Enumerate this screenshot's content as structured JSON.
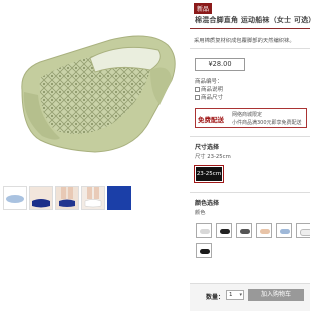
{
  "product": {
    "badge": "新品",
    "title": "棉混合脚直角 运动船袜（女士 可选）",
    "note": "采用棉质复材织成包覆脚部的天然编织袜。",
    "price": "¥28.00",
    "info": [
      "商品编号：",
      "商品说明",
      "商品尺寸"
    ],
    "shipping": {
      "tag": "免费配送",
      "line1": "网络商城限定",
      "line2": "小件商品满300元即享免费配送"
    }
  },
  "size": {
    "title": "尺寸选择",
    "current": "尺寸 23-25cm",
    "options": [
      "23-25cm"
    ]
  },
  "color": {
    "title": "颜色选择",
    "current": "颜色",
    "swatches": [
      {
        "icon": "sock-light-gray",
        "color": "#d8d8d8"
      },
      {
        "icon": "sock-black",
        "color": "#222222"
      },
      {
        "icon": "sock-dark-gray",
        "color": "#555555"
      },
      {
        "icon": "sock-beige",
        "color": "#e8c4a8"
      },
      {
        "icon": "sock-light-blue",
        "color": "#9fb8d8"
      },
      {
        "icon": "sock-white",
        "color": "#eeeeee"
      },
      {
        "icon": "sock-black-2",
        "color": "#1a1a1a"
      }
    ]
  },
  "thumbnails": [
    {
      "icon": "thumb-light-blue-sock",
      "color": "#a9c2e0"
    },
    {
      "icon": "thumb-navy-sock-on-feet",
      "color": "#1c2f8a"
    },
    {
      "icon": "thumb-navy-sock-on-feet-2",
      "color": "#23368f"
    },
    {
      "icon": "thumb-white-sock-on-feet",
      "color": "#f0f0f0"
    },
    {
      "icon": "thumb-blue-swatch",
      "color": "#1b3fa8"
    }
  ],
  "purchase": {
    "qty_label": "数量：",
    "qty_value": "1",
    "cart_label": "加入购物车"
  },
  "colors": {
    "accent": "#8b1a1a",
    "sock": "#c9d2a8"
  }
}
